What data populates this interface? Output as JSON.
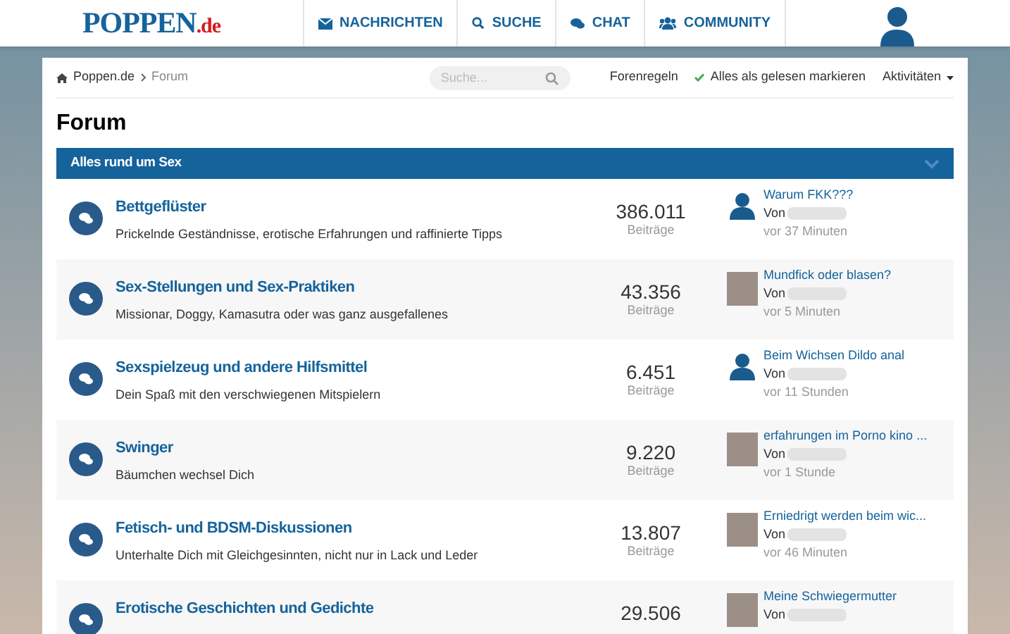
{
  "header": {
    "logo": {
      "name": "POPPEN",
      "suffix": ".de"
    },
    "nav": [
      {
        "label": "NACHRICHTEN"
      },
      {
        "label": "SUCHE"
      },
      {
        "label": "CHAT"
      },
      {
        "label": "COMMUNITY"
      }
    ]
  },
  "breadcrumb": [
    "Poppen.de",
    "Forum"
  ],
  "search": {
    "placeholder": "Suche..."
  },
  "actions": [
    {
      "label": "Forenregeln",
      "kind": "link"
    },
    {
      "label": "Alles als gelesen markieren",
      "kind": "check"
    },
    {
      "label": "Aktivitäten",
      "kind": "dropdown"
    }
  ],
  "title": "Forum",
  "section": {
    "title": "Alles rund um Sex",
    "expanded": true
  },
  "forums": [
    {
      "title": "Bettgeflüster",
      "description": "Prickelnde Geständnisse, erotische Erfahrungen und raffinierte Tipps",
      "count": "386.011",
      "count_label": "Beiträge",
      "last_post": {
        "kind": "silhouette",
        "title": "Warum FKK???",
        "by": "Von",
        "time": "vor 37 Minuten"
      }
    },
    {
      "title": "Sex-Stellungen und Sex-Praktiken",
      "description": "Missionar, Doggy, Kamasutra oder was ganz ausgefallenes",
      "count": "43.356",
      "count_label": "Beiträge",
      "last_post": {
        "kind": "photo",
        "title": "Mundfick oder blasen?",
        "by": "Von",
        "time": "vor 5 Minuten"
      }
    },
    {
      "title": "Sexspielzeug und andere Hilfsmittel",
      "description": "Dein Spaß mit den verschwiegenen Mitspielern",
      "count": "6.451",
      "count_label": "Beiträge",
      "last_post": {
        "kind": "silhouette",
        "title": "Beim Wichsen Dildo anal",
        "by": "Von",
        "time": "vor 11 Stunden"
      }
    },
    {
      "title": "Swinger",
      "description": "Bäumchen wechsel Dich",
      "count": "9.220",
      "count_label": "Beiträge",
      "last_post": {
        "kind": "photo",
        "title": "erfahrungen im Porno kino ...",
        "by": "Von",
        "time": "vor 1 Stunde"
      }
    },
    {
      "title": "Fetisch- und BDSM-Diskussionen",
      "description": "Unterhalte Dich mit Gleichgesinnten, nicht nur in Lack und Leder",
      "count": "13.807",
      "count_label": "Beiträge",
      "last_post": {
        "kind": "photo",
        "title": "Erniedrigt werden beim wic...",
        "by": "Von",
        "time": "vor 46 Minuten"
      }
    },
    {
      "title": "Erotische Geschichten und Gedichte",
      "count": "29.506",
      "last_post": {
        "kind": "photo",
        "title": "Meine Schwiegermutter",
        "by": "Von"
      }
    }
  ]
}
